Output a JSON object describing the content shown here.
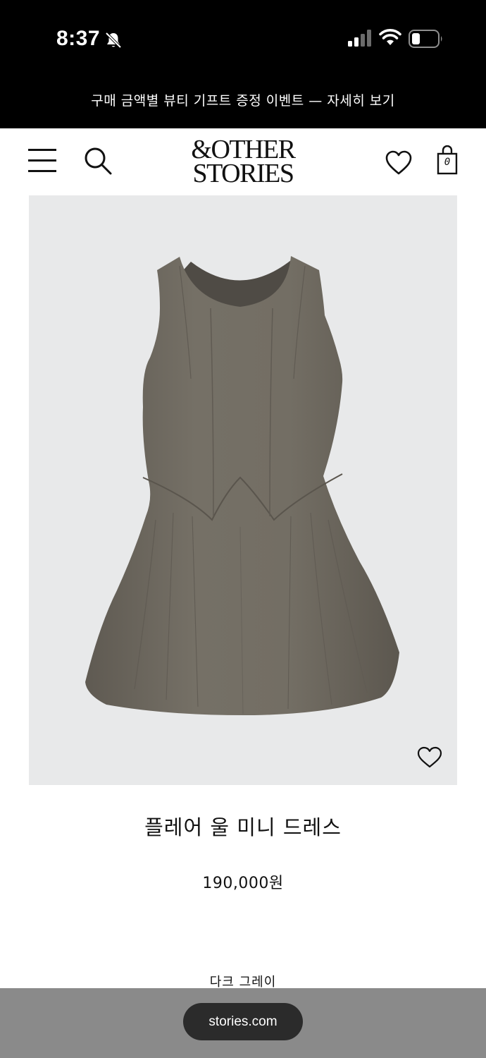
{
  "status_bar": {
    "time": "8:37",
    "icons": [
      "bell-off-icon",
      "cellular-signal-icon",
      "wifi-icon",
      "battery-icon"
    ]
  },
  "promo_banner": {
    "text": "구매 금액별 뷰티 기프트 증정 이벤트 — 자세히 보기"
  },
  "header": {
    "logo_line1": "&OTHER",
    "logo_line2": "STORIES",
    "bag_count": "0",
    "icons": [
      "menu-icon",
      "search-icon",
      "heart-icon",
      "shopping-bag-icon"
    ]
  },
  "product": {
    "name": "플레어 울 미니 드레스",
    "price": "190,000원",
    "color": "다크 그레이",
    "image_background": "#e8e9ea",
    "dress_color": "#6f6a62"
  },
  "browser": {
    "url": "stories.com"
  },
  "colors": {
    "top_bar": "#000000",
    "browser_bar": "#8a8a8a",
    "url_pill": "#2b2b2b"
  }
}
